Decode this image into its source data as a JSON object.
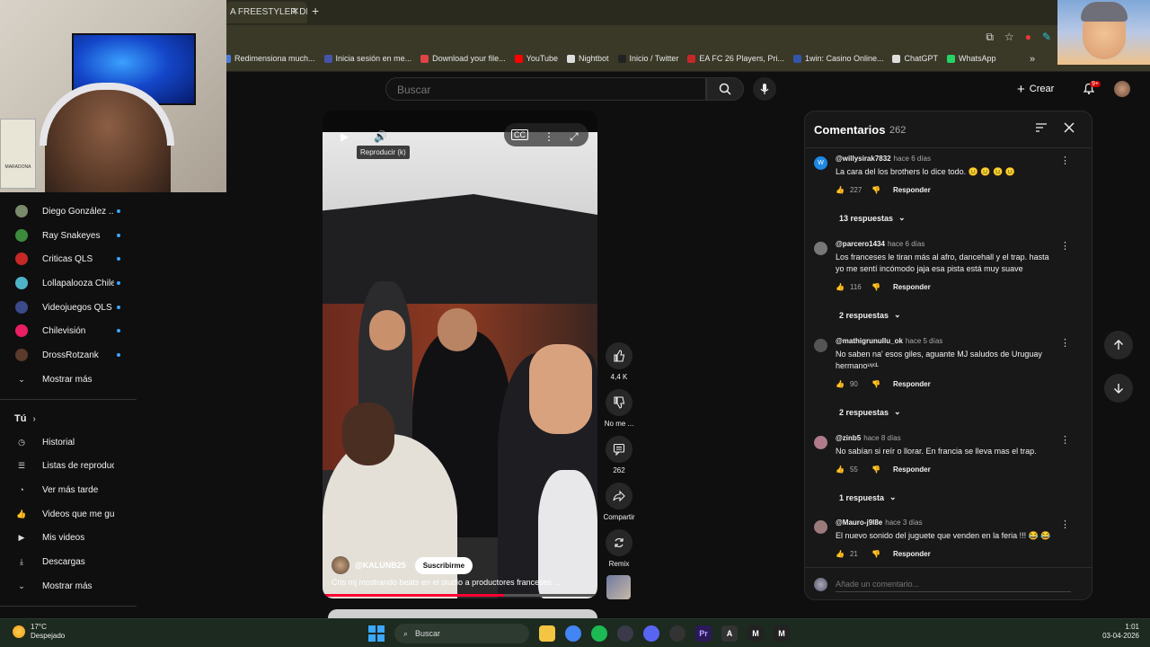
{
  "browser": {
    "tab_title": "A FREESTYLER DE",
    "bookmarks": [
      {
        "label": "Redimensiona much...",
        "color": "#4a7bd8"
      },
      {
        "label": "Inicia sesión en me...",
        "color": "#4455aa"
      },
      {
        "label": "Download your file...",
        "color": "#e04444"
      },
      {
        "label": "YouTube",
        "color": "#ff0000"
      },
      {
        "label": "Nightbot",
        "color": "#dddddd"
      },
      {
        "label": "Inicio / Twitter",
        "color": "#222222"
      },
      {
        "label": "EA FC 26 Players, Pri...",
        "color": "#c62828"
      },
      {
        "label": "1win: Casino Online...",
        "color": "#3355aa"
      },
      {
        "label": "ChatGPT",
        "color": "#dddddd"
      },
      {
        "label": "WhatsApp",
        "color": "#25d366"
      }
    ]
  },
  "webcam": {
    "card_text": "MARADONA"
  },
  "header": {
    "search_placeholder": "Buscar",
    "create_label": "Crear",
    "notifications_badge": "9+"
  },
  "sidebar": {
    "subscriptions": [
      {
        "label": "Diego González ...",
        "color": "#7a8a6a"
      },
      {
        "label": "Ray Snakeyes",
        "color": "#3c8a3c"
      },
      {
        "label": "Criticas QLS",
        "color": "#c62828"
      },
      {
        "label": "Lollapalooza Chile",
        "color": "#4fb3c8"
      },
      {
        "label": "Videojuegos QLS",
        "color": "#3a4a8a"
      },
      {
        "label": "Chilevisión",
        "color": "#e91e63"
      },
      {
        "label": "DrossRotzank",
        "color": "#5a3a2a"
      }
    ],
    "show_more_1": "Mostrar más",
    "you_section": "Tú",
    "you_items": [
      {
        "label": "Historial",
        "icon": "history-icon"
      },
      {
        "label": "Listas de reproducc...",
        "icon": "playlist-icon"
      },
      {
        "label": "Ver más tarde",
        "icon": "clock-icon"
      },
      {
        "label": "Videos que me gus...",
        "icon": "thumbs-up-icon"
      },
      {
        "label": "Mis videos",
        "icon": "video-icon"
      },
      {
        "label": "Descargas",
        "icon": "download-icon"
      }
    ],
    "show_more_2": "Mostrar más"
  },
  "video": {
    "tooltip": "Reproducir (k)",
    "channel": "@KALUNB25",
    "subscribe_label": "Suscribirme",
    "title": "Cris mj mostrando beats en el studio a productores franceses ...",
    "progress": 0.66
  },
  "actions": {
    "likes": "4,4 K",
    "dislike_label": "No me ...",
    "comments": "262",
    "share_label": "Compartir",
    "remix_label": "Remix"
  },
  "comments": {
    "title": "Comentarios",
    "count": "262",
    "items": [
      {
        "user": "@willysirak7832",
        "time": "hace 6 días",
        "text": "La cara del los brothers lo dice todo. 😐 😐 😐 😐",
        "likes": "227",
        "reply": "Responder",
        "replies": "13 respuestas",
        "avatar_color": "#1e88e5",
        "avatar_letter": "W"
      },
      {
        "user": "@parcero1434",
        "time": "hace 6 días",
        "text": "Los franceses le tiran más al afro, dancehall y el trap. hasta yo me sentí incómodo jaja esa pista está muy suave",
        "likes": "116",
        "reply": "Responder",
        "replies": "2 respuestas",
        "avatar_color": "#777777",
        "avatar_letter": ""
      },
      {
        "user": "@mathigrunullu_ok",
        "time": "hace 5 días",
        "text": "No saben na' esos giles, aguante MJ saludos de Uruguay hermanoᵘᵞᶜᴸ",
        "likes": "90",
        "reply": "Responder",
        "replies": "2 respuestas",
        "avatar_color": "#555555",
        "avatar_letter": ""
      },
      {
        "user": "@zinb5",
        "time": "hace 8 días",
        "text": "No sabían si reír o llorar. En francia se lleva mas el trap.",
        "likes": "55",
        "reply": "Responder",
        "replies": "1 respuesta",
        "avatar_color": "#b07a8a",
        "avatar_letter": ""
      },
      {
        "user": "@Mauro-j9l8e",
        "time": "hace 3 días",
        "text": "El nuevo sonido del juguete que venden en la feria !!! 😂 😂",
        "likes": "21",
        "reply": "Responder",
        "replies": "",
        "avatar_color": "#9a7a7a",
        "avatar_letter": ""
      }
    ],
    "add_placeholder": "Añade un comentario..."
  },
  "taskbar": {
    "temperature": "17°C",
    "weather": "Despejado",
    "search": "Buscar",
    "time": "1:01",
    "date": "03-04-2026"
  }
}
